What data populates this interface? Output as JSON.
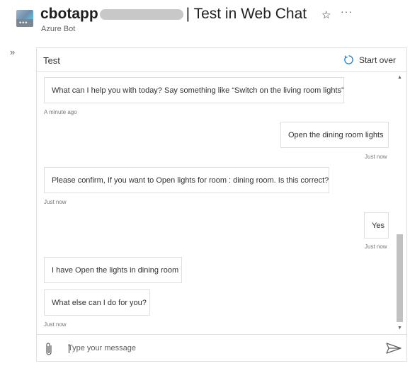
{
  "header": {
    "app_icon": "bot-service-icon",
    "app_name": "cbotapp",
    "title": "| Test in Web Chat",
    "subtitle": "Azure Bot",
    "favorite_icon": "star-icon",
    "more_icon": "ellipsis-icon",
    "more_label": "···"
  },
  "sidebar": {
    "expand_icon": "double-chevron-right-icon",
    "expand_label": "»"
  },
  "chat": {
    "title": "Test",
    "start_over_label": "Start over",
    "messages": [
      {
        "from": "bot",
        "text": "What can I help you with today? Say something like “Switch on the living room lights”",
        "timestamp": "A minute ago"
      },
      {
        "from": "user",
        "text": "Open the dining room lights",
        "timestamp": "Just now"
      },
      {
        "from": "bot",
        "text": "Please confirm, If you want to Open lights for room : dining room. Is this correct?",
        "timestamp": "Just now"
      },
      {
        "from": "user",
        "text": "Yes",
        "timestamp": "Just now"
      },
      {
        "from": "bot",
        "text": "I have Open the lights in dining room",
        "timestamp": ""
      },
      {
        "from": "bot",
        "text": "What else can I do for you?",
        "timestamp": "Just now"
      }
    ],
    "input": {
      "placeholder": "Type your message",
      "value": ""
    },
    "attach_icon": "paperclip-icon",
    "send_icon": "send-icon"
  },
  "colors": {
    "accent": "#0078d4",
    "border": "#e1dfdd",
    "timestamp": "#767676"
  }
}
